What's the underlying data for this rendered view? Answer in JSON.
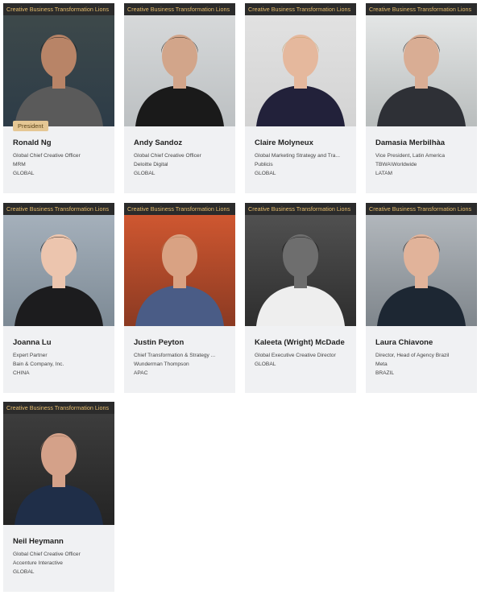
{
  "banner_label": "Creative Business Transformation Lions",
  "cards": [
    {
      "name": "Ronald Ng",
      "role": "President",
      "title": "Global Chief Creative Officer",
      "company": "MRM",
      "region": "GLOBAL",
      "colors": {
        "bg": "#3f4a4a",
        "bg2": "#2d3c48",
        "skin": "#b88467",
        "hair": "#1b1b1b",
        "cloth": "#5a5a5a"
      }
    },
    {
      "name": "Andy Sandoz",
      "title": "Global Chief Creative Officer",
      "company": "Deloitte Digital",
      "region": "GLOBAL",
      "colors": {
        "bg": "#d9dbdc",
        "bg2": "#bcc0c2",
        "skin": "#d2a58a",
        "hair": "#2e2419",
        "cloth": "#1a1a1a"
      }
    },
    {
      "name": "Claire Molyneux",
      "title": "Global Marketing Strategy and Tra...",
      "company": "Publicis",
      "region": "GLOBAL",
      "colors": {
        "bg": "#e3e3e3",
        "bg2": "#d3d3d3",
        "skin": "#e5b89d",
        "hair": "#c6a065",
        "cloth": "#22213a"
      }
    },
    {
      "name": "Damasia Merbilhàa",
      "title": "Vice President, Latin America",
      "company": "TBWA\\Worldwide",
      "region": "LATAM",
      "colors": {
        "bg": "#e8eaea",
        "bg2": "#b9bdbd",
        "skin": "#d9ad94",
        "hair": "#2b211c",
        "cloth": "#2e3036"
      }
    },
    {
      "name": "Joanna Lu",
      "title": "Expert Partner",
      "company": "Bain & Company, Inc.",
      "region": "CHINA",
      "colors": {
        "bg": "#a9b4bf",
        "bg2": "#7d8a95",
        "skin": "#ecc5ae",
        "hair": "#141210",
        "cloth": "#1c1c1e"
      }
    },
    {
      "name": "Justin Peyton",
      "title": "Chief Transformation & Strategy ...",
      "company": "Wunderman Thompson",
      "region": "APAC",
      "colors": {
        "bg": "#d65a32",
        "bg2": "#8b3a22",
        "skin": "#d9a283",
        "hair": "#a87a55",
        "cloth": "#4a5c86"
      }
    },
    {
      "name": "Kaleeta (Wright) McDade",
      "title": "Global Executive Creative Director",
      "company": "",
      "region": "GLOBAL",
      "colors": {
        "bg": "#545454",
        "bg2": "#2e2e2e",
        "skin": "#6e6e6e",
        "hair": "#141414",
        "cloth": "#eeeeee"
      }
    },
    {
      "name": "Laura Chiavone",
      "title": "Director, Head of Agency Brazil",
      "company": "Meta",
      "region": "BRAZIL",
      "colors": {
        "bg": "#b7bcc1",
        "bg2": "#7f868c",
        "skin": "#e1b39a",
        "hair": "#2b1e17",
        "cloth": "#1d2733"
      }
    },
    {
      "name": "Neil Heymann",
      "title": "Global Chief Creative Officer",
      "company": "Accenture Interactive",
      "region": "GLOBAL",
      "colors": {
        "bg": "#3f3f3f",
        "bg2": "#242424",
        "skin": "#d4a189",
        "hair": "#8a6a57",
        "cloth": "#1f2e48"
      }
    }
  ]
}
